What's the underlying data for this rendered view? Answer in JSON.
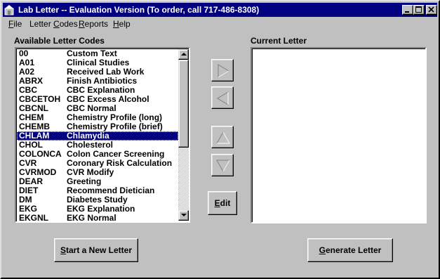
{
  "window": {
    "title": "Lab Letter  --  Evaluation Version  (To order, call 717-486-8308)"
  },
  "menu": {
    "items": [
      {
        "label": "File",
        "mnemonic": "F",
        "rest": "ile"
      },
      {
        "label": "Letter Codes",
        "mnemonic": "",
        "pre": "Letter ",
        "mn": "C",
        "rest": "odes"
      },
      {
        "label": "Reports",
        "mnemonic": "R",
        "rest": "eports"
      },
      {
        "label": "Help",
        "mnemonic": "H",
        "rest": "elp"
      }
    ]
  },
  "available": {
    "label": "Available Letter Codes",
    "selected_index": 8,
    "rows": [
      {
        "code": "00",
        "desc": "Custom Text"
      },
      {
        "code": "A01",
        "desc": "Clinical Studies"
      },
      {
        "code": "A02",
        "desc": "Received Lab Work"
      },
      {
        "code": "ABRX",
        "desc": "Finish Antibiotics"
      },
      {
        "code": "CBC",
        "desc": "CBC Explanation"
      },
      {
        "code": "CBCETOH",
        "desc": "CBC Excess Alcohol"
      },
      {
        "code": "CBCNL",
        "desc": "CBC Normal"
      },
      {
        "code": "CHEM",
        "desc": "Chemistry Profile (long)"
      },
      {
        "code": "CHEMB",
        "desc": "Chemistry Profile (brief)"
      },
      {
        "code": "CHLAM",
        "desc": "Chlamydia"
      },
      {
        "code": "CHOL",
        "desc": "Cholesterol"
      },
      {
        "code": "COLONCA",
        "desc": "Colon Cancer Screening"
      },
      {
        "code": "CVR",
        "desc": "Coronary Risk Calculation"
      },
      {
        "code": "CVRMOD",
        "desc": "CVR Modify"
      },
      {
        "code": "DEAR",
        "desc": "Greeting"
      },
      {
        "code": "DIET",
        "desc": "Recommend Dietician"
      },
      {
        "code": "DM",
        "desc": "Diabetes Study"
      },
      {
        "code": "EKG",
        "desc": "EKG Explanation"
      },
      {
        "code": "EKGNL",
        "desc": "EKG Normal"
      }
    ]
  },
  "current": {
    "label": "Current Letter"
  },
  "buttons": {
    "edit_mn": "E",
    "edit_rest": "dit",
    "start_mn": "S",
    "start_rest": "tart a New Letter",
    "generate_mn": "G",
    "generate_rest": "enerate Letter"
  },
  "icons": {
    "add": "arrow-right-icon",
    "remove": "arrow-left-icon",
    "move_up": "arrow-up-icon",
    "move_down": "arrow-down-icon"
  }
}
